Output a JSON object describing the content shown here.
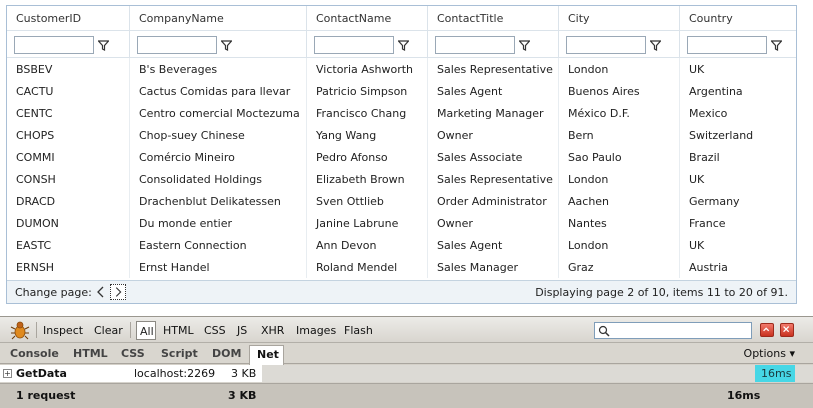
{
  "grid": {
    "columns": [
      "CustomerID",
      "CompanyName",
      "ContactName",
      "ContactTitle",
      "City",
      "Country"
    ],
    "rows": [
      [
        "BSBEV",
        "B's Beverages",
        "Victoria Ashworth",
        "Sales Representative",
        "London",
        "UK"
      ],
      [
        "CACTU",
        "Cactus Comidas para llevar",
        "Patricio Simpson",
        "Sales Agent",
        "Buenos Aires",
        "Argentina"
      ],
      [
        "CENTC",
        "Centro comercial Moctezuma",
        "Francisco Chang",
        "Marketing Manager",
        "México D.F.",
        "Mexico"
      ],
      [
        "CHOPS",
        "Chop-suey Chinese",
        "Yang Wang",
        "Owner",
        "Bern",
        "Switzerland"
      ],
      [
        "COMMI",
        "Comércio Mineiro",
        "Pedro Afonso",
        "Sales Associate",
        "Sao Paulo",
        "Brazil"
      ],
      [
        "CONSH",
        "Consolidated Holdings",
        "Elizabeth Brown",
        "Sales Representative",
        "London",
        "UK"
      ],
      [
        "DRACD",
        "Drachenblut Delikatessen",
        "Sven Ottlieb",
        "Order Administrator",
        "Aachen",
        "Germany"
      ],
      [
        "DUMON",
        "Du monde entier",
        "Janine Labrune",
        "Owner",
        "Nantes",
        "France"
      ],
      [
        "EASTC",
        "Eastern Connection",
        "Ann Devon",
        "Sales Agent",
        "London",
        "UK"
      ],
      [
        "ERNSH",
        "Ernst Handel",
        "Roland Mendel",
        "Sales Manager",
        "Graz",
        "Austria"
      ]
    ],
    "filter_icon": "funnel-filter-icon"
  },
  "pager": {
    "label": "Change page:",
    "info": "Displaying page 2 of 10, items 11 to 20 of 91."
  },
  "firebug": {
    "toolbar": {
      "inspect": "Inspect",
      "clear": "Clear",
      "all": "All",
      "filters": [
        "HTML",
        "CSS",
        "JS",
        "XHR",
        "Images",
        "Flash"
      ],
      "search_placeholder": ""
    },
    "tabs": [
      "Console",
      "HTML",
      "CSS",
      "Script",
      "DOM",
      "Net"
    ],
    "active_tab": "Net",
    "options": "Options ▾",
    "net_request": {
      "name": "GetData",
      "domain": "localhost:2269",
      "size": "3 KB",
      "timing": "16ms"
    },
    "summary": {
      "requests": "1 request",
      "size": "3 KB",
      "time": "16ms"
    },
    "colors": {
      "timing_bar": "#46d7e6",
      "close_button": "#c9321f"
    }
  }
}
